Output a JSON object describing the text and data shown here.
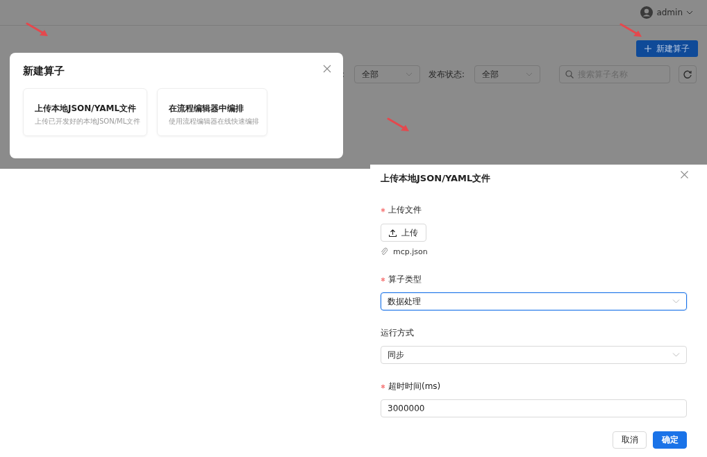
{
  "header": {
    "user": "admin"
  },
  "toolbar": {
    "new_button": "新建算子"
  },
  "filters": [
    {
      "label": ":",
      "value": "全部"
    },
    {
      "label": "发布状态:",
      "value": "全部"
    }
  ],
  "search": {
    "placeholder": "搜索算子名称"
  },
  "modal": {
    "title": "新建算子",
    "options": [
      {
        "title": "上传本地JSON/YAML文件",
        "description": "上传已开发好的本地JSON/ML文件"
      },
      {
        "title": "在流程编辑器中编排",
        "description": "使用流程编辑器在线快速编排"
      }
    ]
  },
  "drawer": {
    "title": "上传本地JSON/YAML文件",
    "fields": [
      {
        "kind": "upload",
        "label": "上传文件",
        "required": true,
        "button": "上传",
        "file": "mcp.json"
      },
      {
        "kind": "select",
        "label": "算子类型",
        "required": true,
        "value": "数据处理",
        "focused": true
      },
      {
        "kind": "select",
        "label": "运行方式",
        "required": false,
        "value": "同步",
        "focused": false
      },
      {
        "kind": "input",
        "label": "超时时间(ms)",
        "required": true,
        "value": "3000000",
        "focused": false
      }
    ],
    "buttons": [
      {
        "kind": "default",
        "label": "取消"
      },
      {
        "kind": "primary",
        "label": "确定"
      }
    ]
  }
}
